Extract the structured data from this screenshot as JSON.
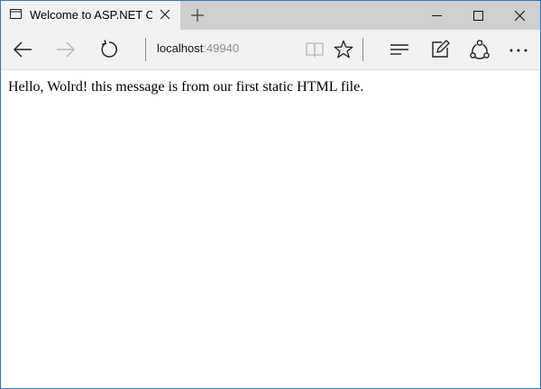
{
  "tab": {
    "title": "Welcome to ASP.NET Co",
    "page_icon": "page-icon",
    "close_icon": "close-icon"
  },
  "new_tab_icon": "plus-icon",
  "window_controls": [
    "minimize-icon",
    "maximize-icon",
    "close-icon"
  ],
  "navigation": {
    "back_icon": "arrow-left-icon",
    "forward_icon": "arrow-right-icon",
    "refresh_icon": "refresh-icon",
    "address_host": "localhost",
    "address_port": ":49940",
    "reading_view_icon": "book-icon",
    "favorites_icon": "star-icon",
    "hub_icon": "hub-icon",
    "web_note_icon": "pencil-square-icon",
    "share_icon": "share-icon",
    "more_icon": "ellipsis-icon"
  },
  "page": {
    "body_text": "Hello, Wolrd! this message is from our first static HTML file."
  },
  "colors": {
    "window_border": "#2b78c2",
    "tabstrip": "#cfcfcf",
    "active_tab": "#f2f2f2",
    "navbar": "#f2f2f2",
    "disabled_icon": "#b8b8b8"
  }
}
